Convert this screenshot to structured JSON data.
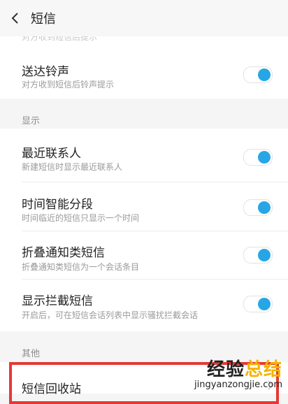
{
  "header": {
    "title": "短信"
  },
  "partial_text": "对方收到短信后提示",
  "items": [
    {
      "title": "送达铃声",
      "subtitle": "对方收到短信后铃声提示",
      "enabled": true
    },
    {
      "title": "最近联系人",
      "subtitle": "新建短信时显示最近联系人",
      "enabled": true
    },
    {
      "title": "时间智能分段",
      "subtitle": "时间临近的短信只显示一个时间",
      "enabled": true
    },
    {
      "title": "折叠通知类短信",
      "subtitle": "折叠通知类短信为一个会话条目",
      "enabled": true
    },
    {
      "title": "显示拦截短信",
      "subtitle": "开启后，可在短信会话列表中显示骚扰拦截会话",
      "enabled": true
    }
  ],
  "sections": {
    "display": "显示",
    "other": "其他"
  },
  "trash": {
    "title": "短信回收站"
  },
  "watermark": {
    "main_a": "经验",
    "main_b": "总结",
    "sub": "jingyanzongjie.com"
  },
  "colors": {
    "accent": "#27a6e6",
    "highlight": "#e53935"
  }
}
